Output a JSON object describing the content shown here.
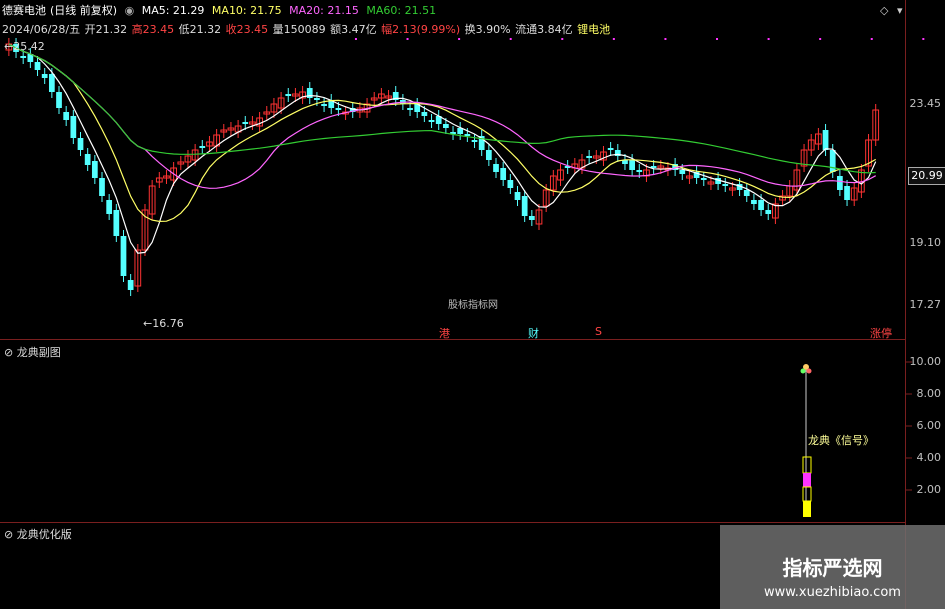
{
  "header": {
    "stock_name": "德赛电池",
    "mode": "(日线 前复权)",
    "ma5": "MA5: 21.29",
    "ma10": "MA10: 21.75",
    "ma20": "MA20: 21.15",
    "ma60": "MA60: 21.51"
  },
  "info": {
    "date": "2024/06/28/五",
    "open": "开21.32",
    "high": "高23.45",
    "low": "低21.32",
    "close": "收23.45",
    "volume": "量150089",
    "amount": "额3.47亿",
    "change": "幅2.13(9.99%)",
    "turnover": "换3.90%",
    "float": "流通3.84亿",
    "sector": "锂电池"
  },
  "price_axis": [
    "23.45",
    "19.10",
    "17.27"
  ],
  "current_price": "20.99",
  "annotations": {
    "high": "25.42",
    "low": "16.76",
    "center": "股标指标网",
    "events": [
      "港",
      "财",
      "S",
      "涨停"
    ]
  },
  "panel2": {
    "title": "龙典副图",
    "axis": [
      "10.00",
      "8.00",
      "6.00",
      "4.00",
      "2.00"
    ],
    "signal_label": "龙典《信号》"
  },
  "panel3": {
    "title": "龙典优化版"
  },
  "watermark": {
    "title": "指标严选网",
    "url": "www.xuezhibiao.com"
  },
  "colors": {
    "up": "#ff3333",
    "down": "#54ffff",
    "ma5": "#ffffff",
    "ma10": "#ffff66",
    "ma20": "#ff66ff",
    "ma60": "#33cc33",
    "signal": "#ffff00",
    "magenta": "#ff33ff"
  },
  "icons": [
    "info-icon",
    "minimize-icon",
    "collapse-icon"
  ]
}
